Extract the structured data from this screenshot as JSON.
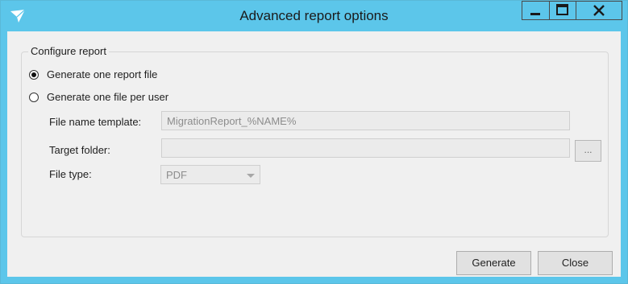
{
  "window": {
    "title": "Advanced report options"
  },
  "group": {
    "title": "Configure report",
    "options": [
      {
        "label": "Generate one report file",
        "selected": true
      },
      {
        "label": "Generate one file per user",
        "selected": false
      }
    ]
  },
  "fields": {
    "file_name_template": {
      "label": "File name template:",
      "value": "MigrationReport_%NAME%"
    },
    "target_folder": {
      "label": "Target folder:",
      "value": "",
      "browse_label": "..."
    },
    "file_type": {
      "label": "File type:",
      "value": "PDF"
    }
  },
  "buttons": {
    "generate": "Generate",
    "close": "Close"
  },
  "colors": {
    "titlebar": "#5cc6ea",
    "client": "#f0f0f0"
  },
  "icons": {
    "app": "paper-plane-icon",
    "minimize": "minimize-icon",
    "maximize": "maximize-icon",
    "close": "close-icon"
  }
}
